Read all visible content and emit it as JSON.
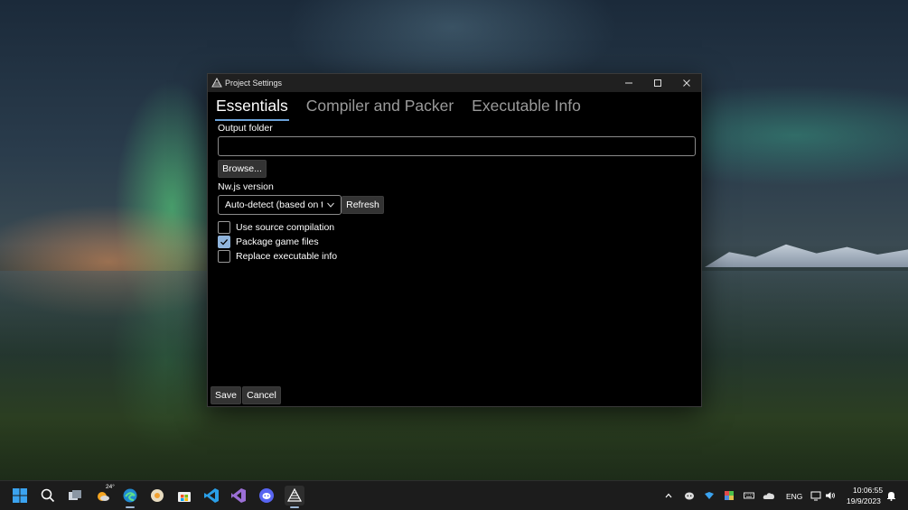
{
  "window": {
    "title": "Project Settings",
    "controls": {
      "minimize": "–",
      "maximize": "☐",
      "close": "✕"
    }
  },
  "tabs": [
    {
      "label": "Essentials",
      "active": true
    },
    {
      "label": "Compiler and Packer",
      "active": false
    },
    {
      "label": "Executable Info",
      "active": false
    }
  ],
  "essentials": {
    "output_folder_label": "Output folder",
    "output_folder_value": "",
    "browse_label": "Browse...",
    "nwjs_version_label": "Nw.js version",
    "nwjs_version_selected": "Auto-detect (based on t",
    "refresh_label": "Refresh",
    "checkboxes": [
      {
        "label": "Use source compilation",
        "checked": false
      },
      {
        "label": "Package game files",
        "checked": true
      },
      {
        "label": "Replace executable info",
        "checked": false
      }
    ]
  },
  "footer": {
    "save_label": "Save",
    "cancel_label": "Cancel"
  },
  "taskbar": {
    "weather_temp": "24°",
    "language": "ENG",
    "time": "10:06:55",
    "date": "19/9/2023"
  },
  "colors": {
    "accent": "#6aa1d8",
    "checked": "#8fb4dc",
    "window_bg": "#000000",
    "titlebar_bg": "#202020"
  }
}
